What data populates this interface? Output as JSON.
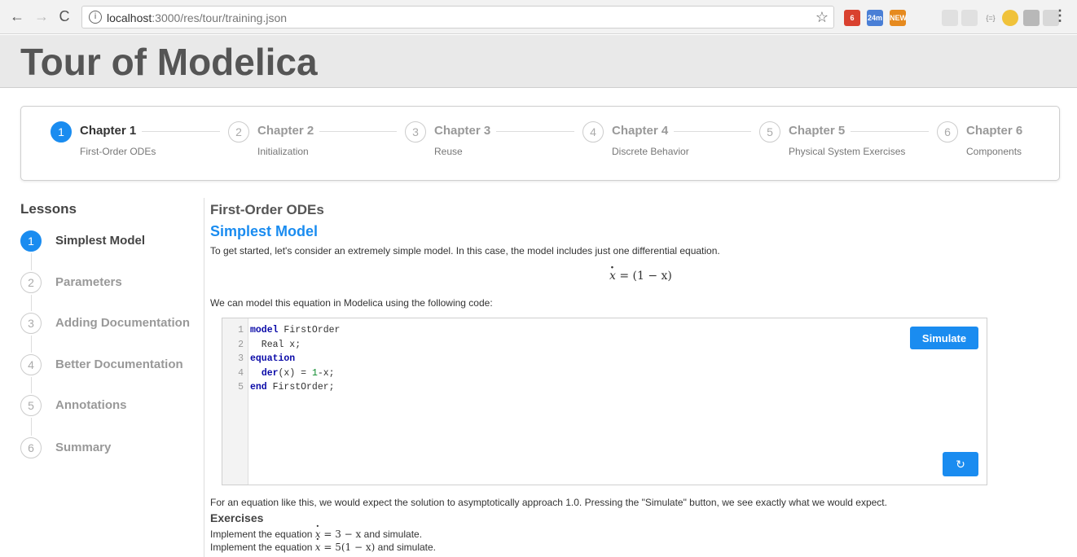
{
  "browser": {
    "url_host": "localhost",
    "url_path": ":3000/res/tour/training.json",
    "extensions": [
      {
        "name": "calendar-ext-icon",
        "badge": "6",
        "color": "#d9412f"
      },
      {
        "name": "timer-ext-icon",
        "badge": "24m",
        "color": "#4a7fd6"
      },
      {
        "name": "new-ext-icon",
        "badge": "NEW",
        "color": "#e68a1f"
      }
    ]
  },
  "header": {
    "title": "Tour of Modelica"
  },
  "chapters": [
    {
      "number": "1",
      "title": "Chapter 1",
      "desc": "First-Order ODEs",
      "active": true
    },
    {
      "number": "2",
      "title": "Chapter 2",
      "desc": "Initialization",
      "active": false
    },
    {
      "number": "3",
      "title": "Chapter 3",
      "desc": "Reuse",
      "active": false
    },
    {
      "number": "4",
      "title": "Chapter 4",
      "desc": "Discrete Behavior",
      "active": false
    },
    {
      "number": "5",
      "title": "Chapter 5",
      "desc": "Physical System Exercises",
      "active": false
    },
    {
      "number": "6",
      "title": "Chapter 6",
      "desc": "Components",
      "active": false
    }
  ],
  "sidebar": {
    "title": "Lessons",
    "items": [
      {
        "number": "1",
        "label": "Simplest Model",
        "active": true
      },
      {
        "number": "2",
        "label": "Parameters",
        "active": false
      },
      {
        "number": "3",
        "label": "Adding Documentation",
        "active": false
      },
      {
        "number": "4",
        "label": "Better Documentation",
        "active": false
      },
      {
        "number": "5",
        "label": "Annotations",
        "active": false
      },
      {
        "number": "6",
        "label": "Summary",
        "active": false
      }
    ]
  },
  "main": {
    "section_heading": "First-Order ODEs",
    "lesson_title": "Simplest Model",
    "intro": "To get started, let's consider an extremely simple model. In this case, the model includes just one differential equation.",
    "equation_rhs": "= (1 − x)",
    "code_intro": "We can model this equation in Modelica using the following code:",
    "code_lines": [
      {
        "num": "1",
        "kw": "model",
        "rest": " FirstOrder"
      },
      {
        "num": "2",
        "kw": "",
        "rest": "  Real x;"
      },
      {
        "num": "3",
        "kw": "equation",
        "rest": ""
      },
      {
        "num": "4",
        "kw": "",
        "rest": "  der(x) = 1-x;"
      },
      {
        "num": "5",
        "kw": "end",
        "rest": " FirstOrder;"
      }
    ],
    "simulate_label": "Simulate",
    "reset_glyph": "↻",
    "after_code": "For an equation like this, we would expect the solution to asymptotically approach 1.0. Pressing the \"Simulate\" button, we see exactly what we would expect.",
    "exercises_title": "Exercises",
    "exercises": [
      {
        "prefix": "Implement the equation ",
        "math": "= 3 − x",
        "suffix": " and simulate."
      },
      {
        "prefix": "Implement the equation ",
        "math": "= 5(1 − x)",
        "suffix": " and simulate."
      }
    ]
  }
}
